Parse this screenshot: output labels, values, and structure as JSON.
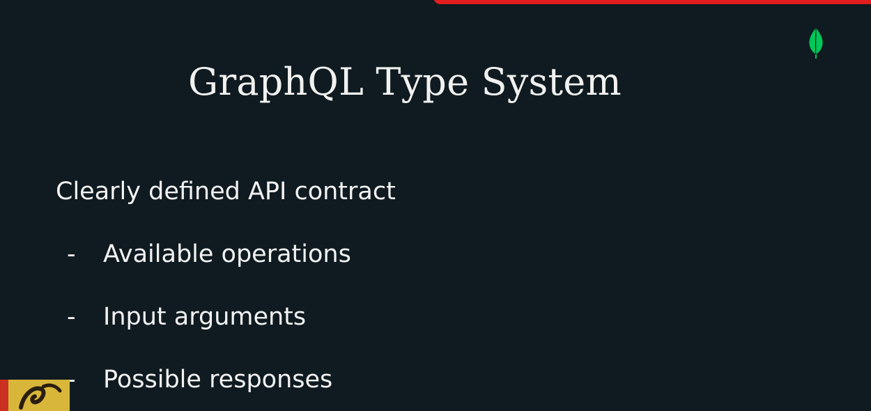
{
  "slide": {
    "title": "GraphQL Type System",
    "heading": "Clearly defined API contract",
    "bullets": [
      {
        "marker": "-",
        "text": "Available operations"
      },
      {
        "marker": "-",
        "text": "Input arguments"
      },
      {
        "marker": "-",
        "text": "Possible responses"
      }
    ]
  },
  "colors": {
    "background": "#0f1b20",
    "text": "#f3f3f3",
    "accent_bar": "#e11d1d",
    "leaf": "#00ed64"
  },
  "icons": {
    "logo": "leaf-logo-icon",
    "corner": "corner-thumbnail-art"
  }
}
